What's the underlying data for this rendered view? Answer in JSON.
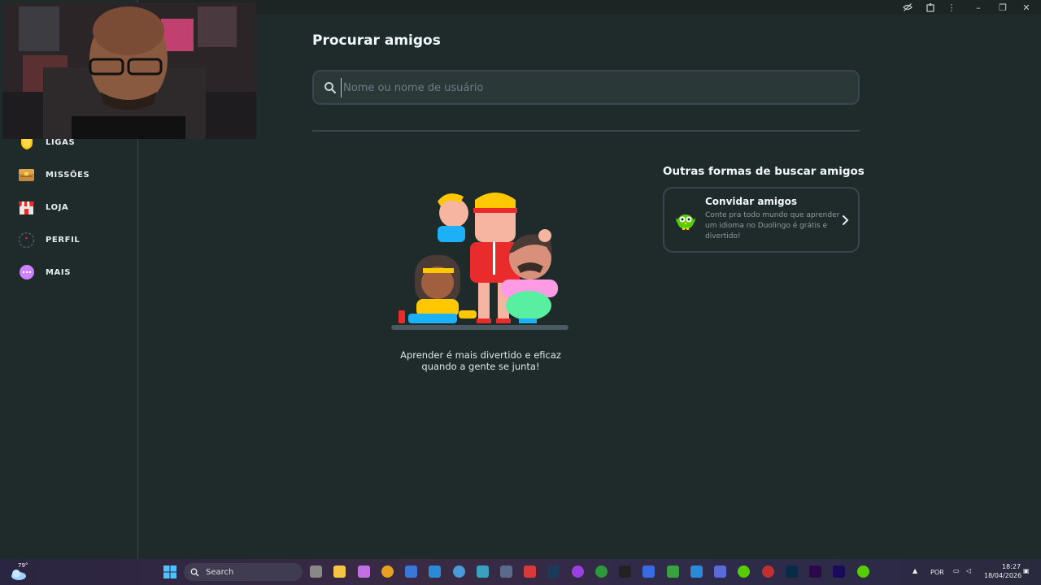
{
  "window": {
    "controls": [
      "eye-off-icon",
      "extension-icon",
      "more-vert-icon",
      "minimize",
      "restore",
      "close"
    ],
    "minimize_glyph": "–",
    "restore_glyph": "❐",
    "close_glyph": "✕",
    "more_glyph": "⋮"
  },
  "sidebar": {
    "items": [
      {
        "label": "LIGAS",
        "icon": "league-shield-icon"
      },
      {
        "label": "MISSÕES",
        "icon": "treasure-chest-icon"
      },
      {
        "label": "LOJA",
        "icon": "shop-icon"
      },
      {
        "label": "PERFIL",
        "icon": "profile-icon"
      },
      {
        "label": "MAIS",
        "icon": "more-dots-icon"
      }
    ]
  },
  "main": {
    "title": "Procurar amigos",
    "search_placeholder": "Nome ou nome de usuário",
    "empty_caption": "Aprender é mais divertido e eficaz quando a gente se junta!"
  },
  "other": {
    "title": "Outras formas de buscar amigos",
    "invite": {
      "title": "Convidar amigos",
      "description": "Conte pra todo mundo que aprender um idioma no Duolingo é grátis e divertido!"
    }
  },
  "taskbar": {
    "weather_temp": "79°",
    "search_label": "Search",
    "language": "POR",
    "time": "18:27",
    "date": "18/04/2026"
  },
  "colors": {
    "background": "#1f2b2a",
    "border": "#37464f",
    "accent_green": "#58cc02"
  }
}
